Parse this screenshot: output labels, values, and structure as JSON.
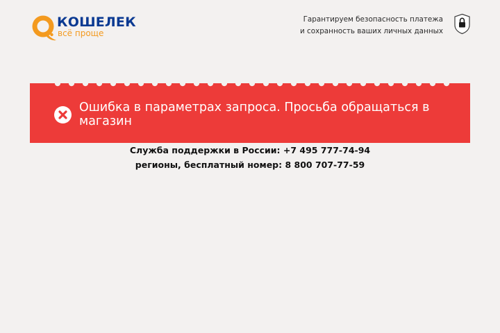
{
  "header": {
    "logo": {
      "brand": "КОШЕЛЕК",
      "tagline": "всё проще",
      "icon": "qiwi-q-icon"
    },
    "guarantee": {
      "line1": "Гарантируем безопасность платежа",
      "line2": "и сохранность ваших личных данных",
      "icon": "shield-lock-icon"
    }
  },
  "error": {
    "message": "Ошибка в параметрах запроса. Просьба обращаться в магазин",
    "icon": "error-x-icon"
  },
  "support": {
    "line1": "Служба поддержки в России: +7 495 777-74-94",
    "line2": "регионы, бесплатный номер: 8 800 707-77-59"
  },
  "colors": {
    "background": "#f3f1f0",
    "error_red": "#ed3b39",
    "brand_blue": "#0b3a92",
    "brand_orange": "#f39a1f"
  }
}
